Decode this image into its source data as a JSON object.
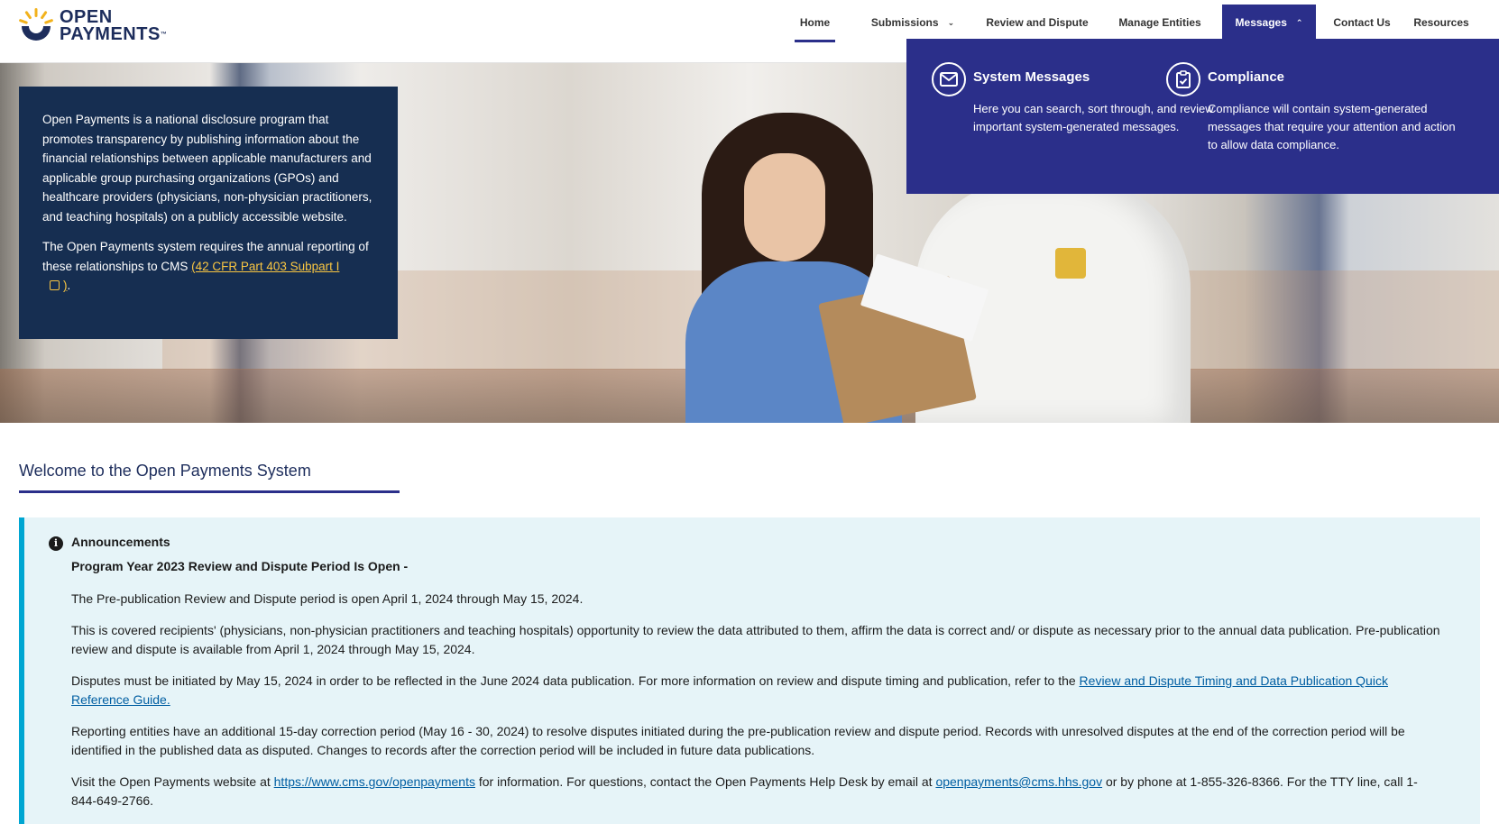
{
  "header": {
    "logo": {
      "line1": "OPEN",
      "line2": "PAYMENTS",
      "tm": "™"
    },
    "nav": {
      "home": "Home",
      "submissions": "Submissions",
      "review_dispute": "Review and Dispute",
      "manage_entities": "Manage Entities",
      "messages": "Messages",
      "contact": "Contact Us",
      "resources": "Resources"
    },
    "colors": {
      "accent": "#2b2f8a",
      "brand": "#1d2d5c"
    }
  },
  "dropdown": {
    "system_messages": {
      "icon": "envelope-icon",
      "title": "System Messages",
      "desc": "Here you can search, sort through, and review important system-generated messages."
    },
    "compliance": {
      "icon": "clipboard-check-icon",
      "title": "Compliance",
      "desc": "Compliance will contain system-generated messages that require your attention and action to allow data compliance."
    }
  },
  "hero": {
    "p1": "Open Payments is a national disclosure program that promotes transparency by publishing information about the financial relationships between applicable manufacturers and applicable group purchasing organizations (GPOs) and healthcare providers (physicians, non-physician practitioners, and teaching hospitals) on a publicly accessible website.",
    "p2_prefix": "The Open Payments system requires the annual reporting of these relationships to CMS ",
    "p2_link": "(42 CFR Part 403 Subpart I",
    "p2_link_close": ")",
    "p2_suffix": "."
  },
  "welcome": {
    "title": "Welcome to the Open Payments System"
  },
  "announcements": {
    "title": "Announcements",
    "subtitle": "Program Year 2023 Review and Dispute Period Is Open -",
    "p1": "The Pre-publication Review and Dispute period is open April 1, 2024 through May 15, 2024.",
    "p2": "This is covered recipients' (physicians, non-physician practitioners and teaching hospitals) opportunity to review the data attributed to them, affirm the data is correct and/ or dispute as necessary prior to the annual data publication. Pre-publication review and dispute is available from April 1, 2024 through May 15, 2024.",
    "p3_prefix": "Disputes must be initiated by May 15, 2024 in order to be reflected in the June 2024 data publication. For more information on review and dispute timing and publication, refer to the ",
    "p3_link": "Review and Dispute Timing and Data Publication Quick Reference Guide.",
    "p4": "Reporting entities have an additional 15-day correction period (May 16 - 30, 2024) to resolve disputes initiated during the pre-publication review and dispute period. Records with unresolved disputes at the end of the correction period will be identified in the published data as disputed. Changes to records after the correction period will be included in future data publications.",
    "p5_prefix": "Visit the Open Payments website at ",
    "p5_link1": "https://www.cms.gov/openpayments",
    "p5_mid": " for information. For questions, contact the Open Payments Help Desk by email at ",
    "p5_link2": "openpayments@cms.hhs.gov",
    "p5_suffix": " or by phone at 1-855-326-8366. For the TTY line, call 1-844-649-2766."
  }
}
